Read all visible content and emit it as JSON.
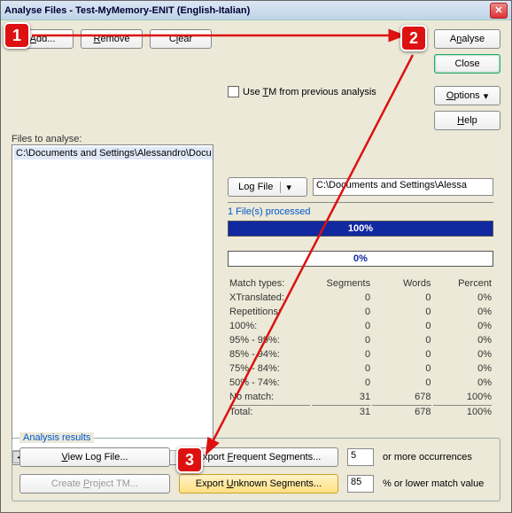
{
  "window": {
    "title": "Analyse Files - Test-MyMemory-ENIT  (English-Italian)"
  },
  "toolbar": {
    "add": "Add...",
    "remove": "Remove",
    "clear": "Clear",
    "analyse": "Analyse",
    "close": "Close",
    "options": "Options",
    "help": "Help"
  },
  "files": {
    "label": "Files to analyse:",
    "entries": [
      "C:\\Documents and Settings\\Alessandro\\Docu"
    ]
  },
  "tm_checkbox": {
    "label": "Use TM from previous analysis"
  },
  "logfile": {
    "button": "Log File",
    "path": "C:\\Documents and Settings\\Alessa"
  },
  "progress": {
    "processed_label": "1 File(s) processed",
    "bar1": "100%",
    "bar2": "0%"
  },
  "stats": {
    "headers": [
      "Match types:",
      "Segments",
      "Words",
      "Percent"
    ],
    "rows": [
      {
        "label": "XTranslated:",
        "segments": "0",
        "words": "0",
        "percent": "0%"
      },
      {
        "label": "Repetitions:",
        "segments": "0",
        "words": "0",
        "percent": "0%"
      },
      {
        "label": "100%:",
        "segments": "0",
        "words": "0",
        "percent": "0%"
      },
      {
        "label": "95% - 99%:",
        "segments": "0",
        "words": "0",
        "percent": "0%"
      },
      {
        "label": "85% - 94%:",
        "segments": "0",
        "words": "0",
        "percent": "0%"
      },
      {
        "label": "75% - 84%:",
        "segments": "0",
        "words": "0",
        "percent": "0%"
      },
      {
        "label": "50% - 74%:",
        "segments": "0",
        "words": "0",
        "percent": "0%"
      },
      {
        "label": "No match:",
        "segments": "31",
        "words": "678",
        "percent": "100%"
      }
    ],
    "total": {
      "label": "Total:",
      "segments": "31",
      "words": "678",
      "percent": "100%"
    }
  },
  "results": {
    "legend": "Analysis results",
    "view_log": "View Log File...",
    "export_freq": "Export Frequent Segments...",
    "freq_val": "5",
    "freq_suffix": "or more occurrences",
    "create_tm": "Create Project TM...",
    "export_unknown": "Export Unknown Segments...",
    "unknown_val": "85",
    "unknown_suffix": "% or lower match value"
  },
  "annotations": {
    "b1": "1",
    "b2": "2",
    "b3": "3"
  }
}
